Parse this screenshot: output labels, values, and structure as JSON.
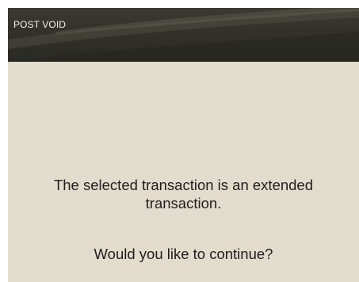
{
  "dialog": {
    "title": "POST VOID",
    "message_line1": "The selected transaction is an extended",
    "message_line2": "transaction.",
    "question": "Would you like to continue?"
  },
  "colors": {
    "header_background": "#303029",
    "header_text": "#f2efe6",
    "body_background": "#e2dccd",
    "body_text": "#1e1e1e"
  }
}
